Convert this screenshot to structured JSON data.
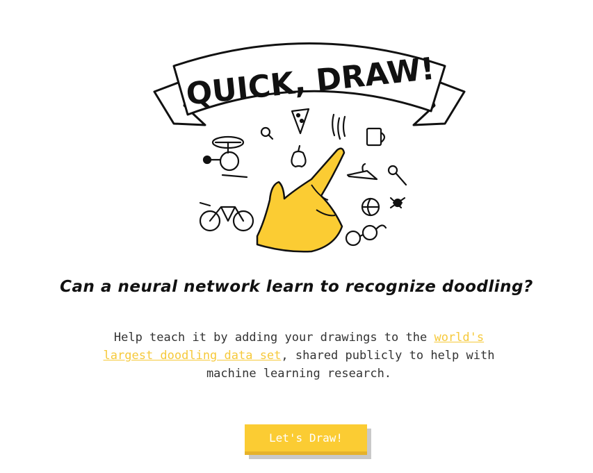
{
  "hero": {
    "logo_text": "QUICK, DRAW!",
    "icons": [
      "helicopter-icon",
      "lightbulb-icon",
      "pizza-icon",
      "steam-icon",
      "mug-icon",
      "apple-icon",
      "hanger-icon",
      "pushpin-icon",
      "bicycle-icon",
      "basketball-icon",
      "spider-icon",
      "glasses-icon",
      "pointing-hand-icon"
    ]
  },
  "main": {
    "tagline": "Can a neural network learn to recognize doodling?",
    "desc_before": "Help teach it by adding your drawings to the ",
    "desc_link": "world's largest doodling data set",
    "desc_after": ", shared publicly to help with machine learning research.",
    "cta_label": "Let's Draw!"
  },
  "colors": {
    "accent": "#fbcc33",
    "link": "#f6c93a"
  }
}
